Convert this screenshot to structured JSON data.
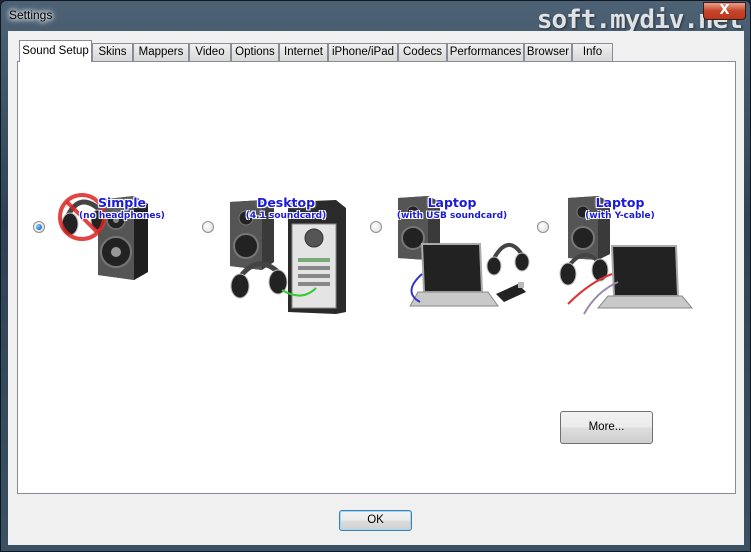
{
  "window": {
    "title": "Settings",
    "close_glyph": "X",
    "watermark": "soft.mydiv.net"
  },
  "tabs": [
    {
      "label": "Sound Setup",
      "active": true
    },
    {
      "label": "Skins"
    },
    {
      "label": "Mappers"
    },
    {
      "label": "Video"
    },
    {
      "label": "Options"
    },
    {
      "label": "Internet"
    },
    {
      "label": "iPhone/iPad"
    },
    {
      "label": "Codecs"
    },
    {
      "label": "Performances"
    },
    {
      "label": "Browser"
    },
    {
      "label": "Info"
    }
  ],
  "sound_setup": {
    "options": [
      {
        "title": "Simple",
        "subtitle": "(no headphones)",
        "selected": true,
        "icons": [
          "no-headphones-icon",
          "speaker-icon"
        ]
      },
      {
        "title": "Desktop",
        "subtitle": "(4.1 soundcard)",
        "selected": false,
        "icons": [
          "speaker-icon",
          "headphones-icon",
          "pc-tower-icon"
        ]
      },
      {
        "title": "Laptop",
        "subtitle": "(with USB soundcard)",
        "selected": false,
        "icons": [
          "speaker-icon",
          "laptop-icon",
          "headphones-icon",
          "usb-soundcard-icon"
        ]
      },
      {
        "title": "Laptop",
        "subtitle": "(with Y-cable)",
        "selected": false,
        "icons": [
          "speaker-icon",
          "headphones-icon",
          "laptop-icon",
          "y-cable-icon"
        ]
      }
    ],
    "more_label": "More..."
  },
  "ok_label": "OK",
  "colors": {
    "option_title": "#1a1ad8",
    "radio_selected": "#2e7bd0"
  }
}
